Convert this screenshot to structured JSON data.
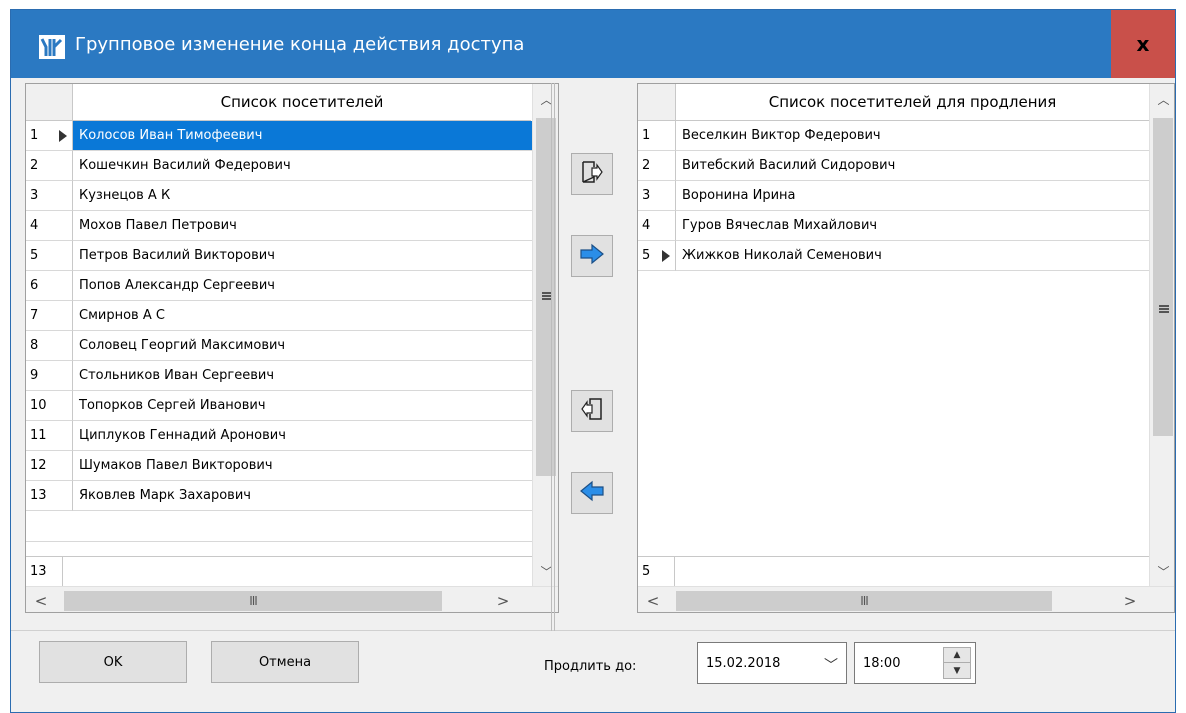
{
  "window": {
    "title": "Групповое изменение конца действия доступа",
    "close_label": "x"
  },
  "left_grid": {
    "header": "Список посетителей",
    "rows": [
      {
        "num": "1",
        "name": "Колосов Иван Тимофеевич"
      },
      {
        "num": "2",
        "name": "Кошечкин Василий Федерович"
      },
      {
        "num": "3",
        "name": "Кузнецов А К"
      },
      {
        "num": "4",
        "name": "Мохов Павел Петрович"
      },
      {
        "num": "5",
        "name": "Петров Василий Викторович"
      },
      {
        "num": "6",
        "name": "Попов Александр Сергеевич"
      },
      {
        "num": "7",
        "name": "Смирнов А С"
      },
      {
        "num": "8",
        "name": "Соловец Георгий Максимович"
      },
      {
        "num": "9",
        "name": "Стольников Иван Сергеевич"
      },
      {
        "num": "10",
        "name": "Топорков Сергей Иванович"
      },
      {
        "num": "11",
        "name": "Циплуков Геннадий Аронович"
      },
      {
        "num": "12",
        "name": "Шумаков Павел Викторович"
      },
      {
        "num": "13",
        "name": "Яковлев Марк Захарович"
      }
    ],
    "selected_index": 0,
    "footer_count": "13",
    "hscroll_grip": "III"
  },
  "right_grid": {
    "header": "Список посетителей для продления",
    "rows": [
      {
        "num": "1",
        "name": "Веселкин Виктор Федерович"
      },
      {
        "num": "2",
        "name": "Витебский Василий Сидорович"
      },
      {
        "num": "3",
        "name": "Воронина Ирина"
      },
      {
        "num": "4",
        "name": "Гуров Вячеслав Михайлович"
      },
      {
        "num": "5",
        "name": "Жижков Николай Семенович"
      }
    ],
    "current_index": 4,
    "footer_count": "5",
    "hscroll_grip": "III"
  },
  "icons": {
    "move_all_right": "move-all-right-icon",
    "move_right": "arrow-right-icon",
    "move_all_left": "move-all-left-icon",
    "move_left": "arrow-left-icon",
    "accent": "#2b8ee8"
  },
  "buttons": {
    "ok": "OK",
    "cancel": "Отмена"
  },
  "extend": {
    "label": "Продлить до:",
    "date": "15.02.2018",
    "time": "18:00"
  }
}
